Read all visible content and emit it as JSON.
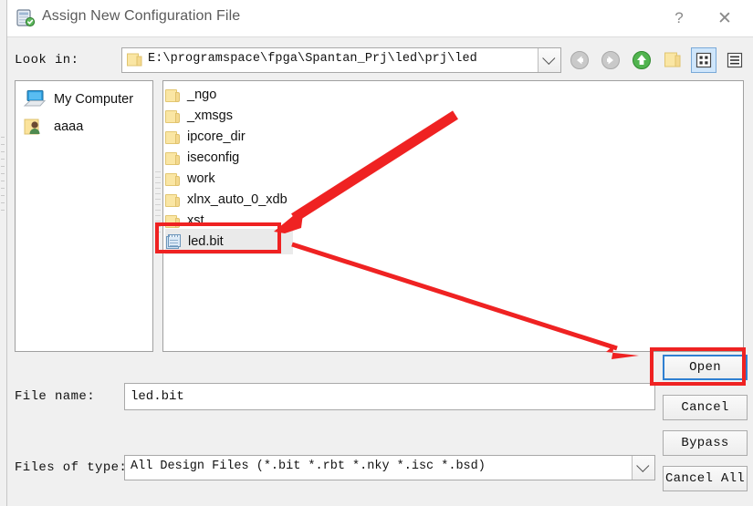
{
  "window": {
    "title": "Assign New Configuration File",
    "app_icon": "configuration-file-icon",
    "help_label": "?",
    "close_label": "✕"
  },
  "toolbar": {
    "lookin_label": "Look in:",
    "path_value": "E:\\programspace\\fpga\\Spantan_Prj\\led\\prj\\led",
    "path_folder_icon": "folder-icon",
    "dropdown_icon": "chevron-down-icon",
    "buttons": [
      {
        "name": "back-button",
        "icon": "arrow-left-circle-icon",
        "label": ""
      },
      {
        "name": "forward-button",
        "icon": "arrow-right-circle-icon",
        "label": ""
      },
      {
        "name": "parent-directory-button",
        "icon": "arrow-up-circle-icon",
        "label": ""
      },
      {
        "name": "new-folder-button",
        "icon": "folder-icon",
        "label": ""
      },
      {
        "name": "list-view-button",
        "icon": "grid-view-icon",
        "label": ""
      },
      {
        "name": "detail-view-button",
        "icon": "detail-view-icon",
        "label": ""
      }
    ]
  },
  "sidebar": {
    "items": [
      {
        "label": "My Computer",
        "icon": "computer-icon"
      },
      {
        "label": "aaaa",
        "icon": "user-folder-icon"
      }
    ]
  },
  "filelist": {
    "items": [
      {
        "name": "_ngo",
        "type": "folder",
        "selected": false
      },
      {
        "name": "_xmsgs",
        "type": "folder",
        "selected": false
      },
      {
        "name": "ipcore_dir",
        "type": "folder",
        "selected": false
      },
      {
        "name": "iseconfig",
        "type": "folder",
        "selected": false
      },
      {
        "name": "work",
        "type": "folder",
        "selected": false
      },
      {
        "name": "xlnx_auto_0_xdb",
        "type": "folder",
        "selected": false
      },
      {
        "name": "xst",
        "type": "folder",
        "selected": false
      },
      {
        "name": "led.bit",
        "type": "file",
        "selected": true
      }
    ]
  },
  "fields": {
    "filename_label": "File name:",
    "filename_value": "led.bit",
    "filetype_label": "Files of type:",
    "filetype_value": "All Design Files (*.bit *.rbt *.nky *.isc *.bsd)"
  },
  "buttons": {
    "open": "Open",
    "cancel": "Cancel",
    "bypass": "Bypass",
    "cancel_all": "Cancel All"
  },
  "annotations": {
    "accent_color": "#ef2222",
    "focus_color": "#2f7fd1",
    "highlight_boxes": [
      "led-bit-row",
      "open-button"
    ],
    "arrows": [
      "arrow-to-led-bit",
      "arrow-to-open-button"
    ]
  }
}
